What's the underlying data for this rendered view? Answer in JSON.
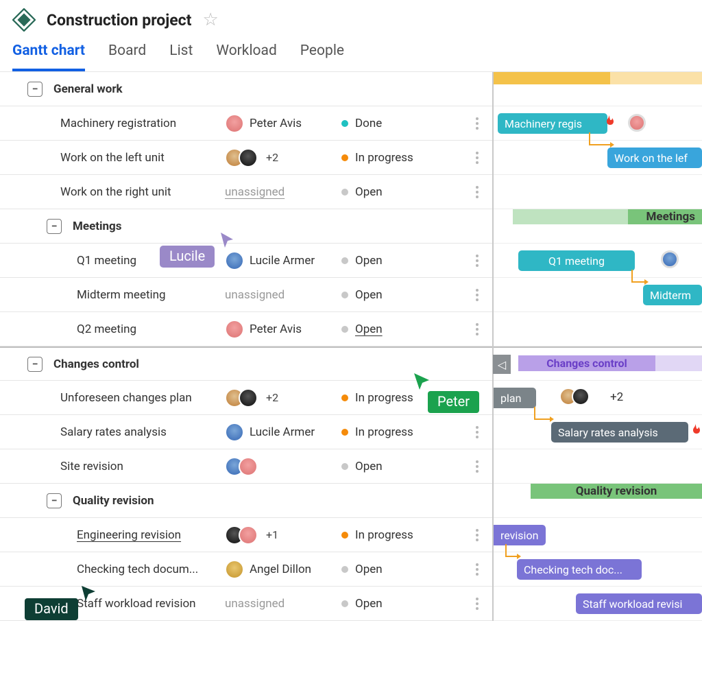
{
  "project": {
    "title": "Construction project"
  },
  "tabs": {
    "gantt": "Gantt chart",
    "board": "Board",
    "list": "List",
    "workload": "Workload",
    "people": "People"
  },
  "labels": {
    "unassigned": "unassigned",
    "plus2": "+2",
    "plus1": "+1"
  },
  "status": {
    "done": "Done",
    "in_progress": "In progress",
    "open": "Open"
  },
  "groups": {
    "general_work": "General work",
    "meetings": "Meetings",
    "changes_control": "Changes control",
    "quality_revision": "Quality revision"
  },
  "tasks": {
    "machinery_registration": {
      "name": "Machinery registration",
      "assignee": "Peter Avis",
      "status": "Done"
    },
    "work_left_unit": {
      "name": "Work on the left unit",
      "assignee_extra": "+2",
      "status": "In progress"
    },
    "work_right_unit": {
      "name": "Work on the right unit",
      "assignee": "unassigned",
      "status": "Open"
    },
    "q1_meeting": {
      "name": "Q1 meeting",
      "assignee": "Lucile Armer",
      "status": "Open"
    },
    "midterm_meeting": {
      "name": "Midterm meeting",
      "assignee": "unassigned",
      "status": "Open"
    },
    "q2_meeting": {
      "name": "Q2 meeting",
      "assignee": "Peter Avis",
      "status": "Open"
    },
    "unforeseen_changes": {
      "name": "Unforeseen changes plan",
      "assignee_extra": "+2",
      "status": "In progress"
    },
    "salary_rates": {
      "name": "Salary rates analysis",
      "assignee": "Lucile Armer",
      "status": "In progress"
    },
    "site_revision": {
      "name": "Site revision",
      "status": "Open"
    },
    "engineering_revision": {
      "name": "Engineering revision",
      "assignee_extra": "+1",
      "status": "In progress"
    },
    "checking_tech": {
      "name": "Checking tech docum...",
      "assignee": "Angel Dillon",
      "status": "Open"
    },
    "staff_workload": {
      "name": "Staff workload revision",
      "assignee": "unassigned",
      "status": "Open"
    }
  },
  "gantt": {
    "machinery": "Machinery regis",
    "work_left": "Work on the lef",
    "meetings": "Meetings",
    "q1": "Q1 meeting",
    "midterm": "Midterm",
    "changes": "Changes control",
    "plan": "plan",
    "plus2": "+2",
    "salary": "Salary rates analysis",
    "quality": "Quality revision",
    "revision": "revision",
    "checking": "Checking tech doc...",
    "staff": "Staff workload revisi"
  },
  "cursors": {
    "lucile": "Lucile",
    "peter": "Peter",
    "david": "David"
  }
}
